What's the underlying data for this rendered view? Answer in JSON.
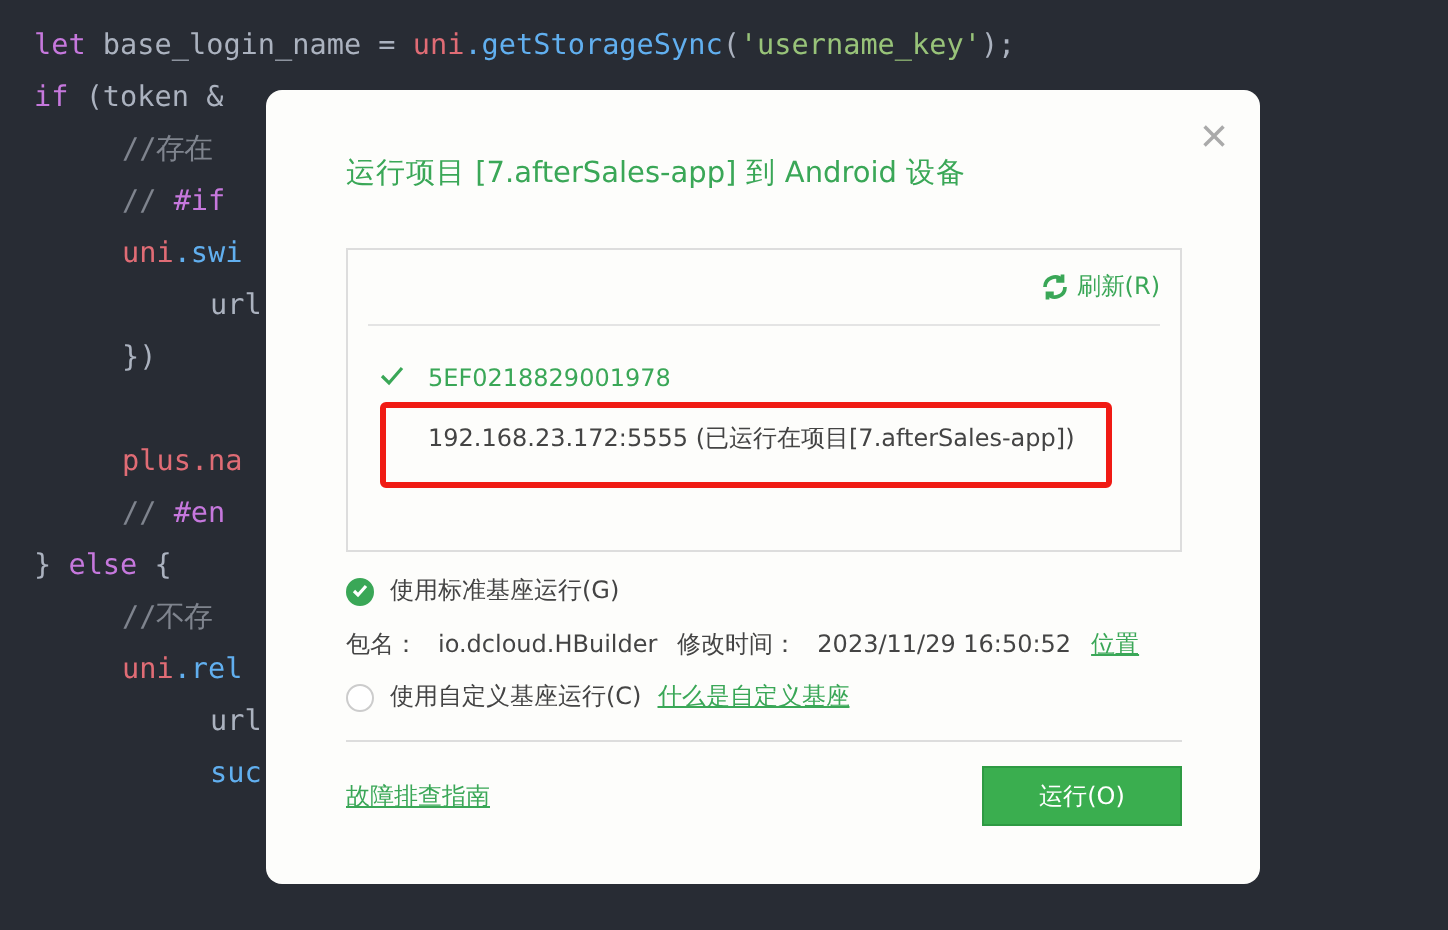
{
  "editor": {
    "lines": [
      {
        "tokens": [
          {
            "kind": "keyword",
            "text": "let"
          },
          {
            "kind": "plain",
            "text": " base_login_name = "
          },
          {
            "kind": "object",
            "text": "uni"
          },
          {
            "kind": "method",
            "text": ".getStorageSync"
          },
          {
            "kind": "plain",
            "text": "("
          },
          {
            "kind": "string",
            "text": "'username_key'"
          },
          {
            "kind": "plain",
            "text": ");"
          }
        ]
      },
      {
        "tokens": [
          {
            "kind": "keyword",
            "text": "if"
          },
          {
            "kind": "plain",
            "text": " (token &"
          }
        ],
        "children": [
          {
            "kind": "code",
            "tokens": [
              {
                "kind": "comment",
                "text": "//存在"
              }
            ]
          },
          {
            "kind": "code",
            "tokens": [
              {
                "kind": "comment",
                "text": "// "
              },
              {
                "kind": "keyword",
                "text": "#if"
              }
            ]
          },
          {
            "kind": "code",
            "tokens": [
              {
                "kind": "object",
                "text": "uni"
              },
              {
                "kind": "method",
                "text": ".swi"
              }
            ],
            "children": [
              {
                "tokens": [
                  {
                    "kind": "plain",
                    "text": "url"
                  }
                ]
              }
            ]
          },
          {
            "kind": "code",
            "tokens": [
              {
                "kind": "plain",
                "text": "})"
              }
            ]
          },
          {
            "kind": "blank"
          },
          {
            "kind": "code",
            "tokens": [
              {
                "kind": "object",
                "text": "plus"
              },
              {
                "kind": "object",
                "text": ".na"
              }
            ]
          },
          {
            "kind": "code",
            "tokens": [
              {
                "kind": "comment",
                "text": "// "
              },
              {
                "kind": "keyword",
                "text": "#en"
              }
            ]
          }
        ]
      },
      {
        "tokens": [
          {
            "kind": "plain",
            "text": "} "
          },
          {
            "kind": "keyword",
            "text": "else"
          },
          {
            "kind": "plain",
            "text": " {"
          }
        ],
        "children": [
          {
            "tokens": [
              {
                "kind": "comment",
                "text": "//不存"
              }
            ]
          },
          {
            "tokens": [
              {
                "kind": "object",
                "text": "uni"
              },
              {
                "kind": "method",
                "text": ".rel"
              }
            ],
            "children": [
              {
                "tokens": [
                  {
                    "kind": "plain",
                    "text": "url"
                  }
                ]
              },
              {
                "tokens": [
                  {
                    "kind": "method",
                    "text": "suc"
                  }
                ]
              }
            ]
          }
        ]
      }
    ]
  },
  "dialog": {
    "title": "运行项目 [7.afterSales-app] 到 Android 设备",
    "close": "×",
    "refresh": "刷新(R)",
    "devices": [
      {
        "name": "5EF0218829001978",
        "selected": true,
        "highlighted": false
      },
      {
        "name": "192.168.23.172:5555 (已运行在项目[7.afterSales-app])",
        "selected": false,
        "highlighted": true
      }
    ],
    "options": [
      {
        "label": "使用标准基座运行(G)",
        "selected": true
      },
      {
        "label": "使用自定义基座运行(C)",
        "selected": false,
        "link": "什么是自定义基座"
      }
    ],
    "package": {
      "name_label": "包名：",
      "name": "io.dcloud.HBuilder",
      "time_label": "修改时间：",
      "time": "2023/11/29 16:50:52",
      "link": "位置"
    },
    "help_link": "故障排查指南",
    "run_button": "运行(O)"
  }
}
